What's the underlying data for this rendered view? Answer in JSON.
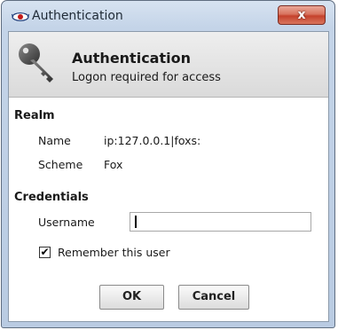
{
  "window": {
    "title": "Authentication",
    "close_glyph": "x",
    "app_icon": "fox-eye-icon"
  },
  "header": {
    "icon": "key-icon",
    "title": "Authentication",
    "subtitle": "Logon required for access"
  },
  "realm": {
    "section_label": "Realm",
    "name_label": "Name",
    "name_value": "ip:127.0.0.1|foxs:",
    "scheme_label": "Scheme",
    "scheme_value": "Fox"
  },
  "credentials": {
    "section_label": "Credentials",
    "username_label": "Username",
    "username_value": "",
    "remember_label": "Remember this user",
    "remember_checked": true,
    "check_glyph": "✔"
  },
  "buttons": {
    "ok_label": "OK",
    "cancel_label": "Cancel"
  },
  "colors": {
    "frame": "#c4d4e8",
    "close_button": "#c5412b",
    "header_band": "#e4e4e4"
  }
}
